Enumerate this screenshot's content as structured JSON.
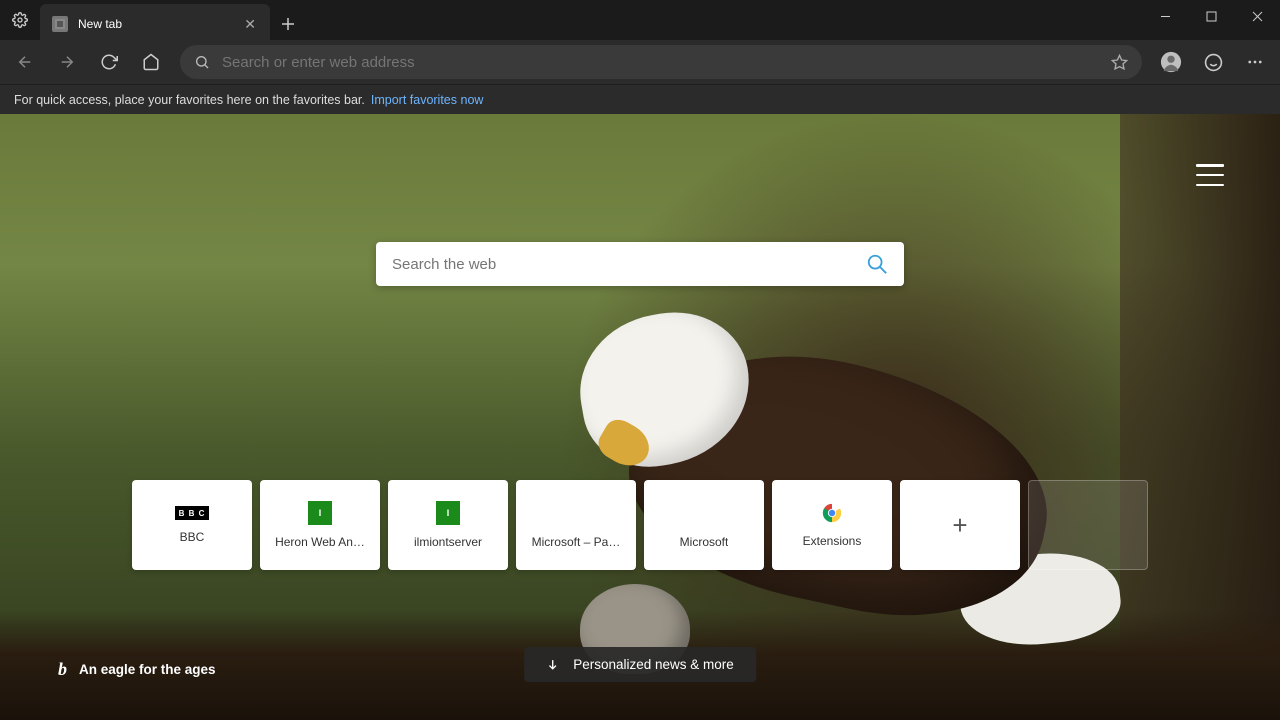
{
  "tab": {
    "title": "New tab"
  },
  "toolbar": {
    "address_placeholder": "Search or enter web address"
  },
  "favbar": {
    "text": "For quick access, place your favorites here on the favorites bar.",
    "link": "Import favorites now"
  },
  "ntp": {
    "search_placeholder": "Search the web",
    "caption": "An eagle for the ages",
    "news_label": "Personalized news & more",
    "tiles": [
      {
        "label": "BBC",
        "icon": "bbc"
      },
      {
        "label": "Heron Web An…",
        "icon": "green"
      },
      {
        "label": "ilmiontserver",
        "icon": "green"
      },
      {
        "label": "Microsoft – Pa…",
        "icon": "ms"
      },
      {
        "label": "Microsoft",
        "icon": "ms"
      },
      {
        "label": "Extensions",
        "icon": "ext"
      }
    ]
  }
}
